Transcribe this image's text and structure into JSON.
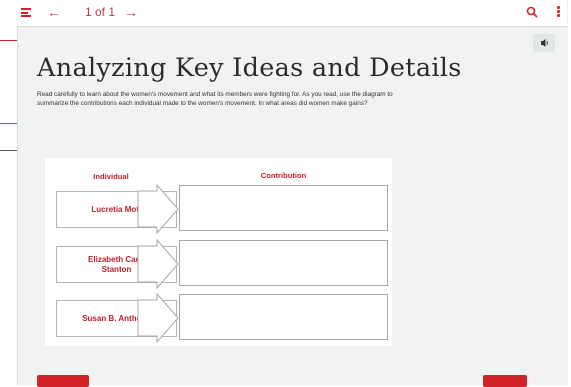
{
  "topbar": {
    "prev_arrow": "←",
    "page_indicator": "1 of 1",
    "next_arrow": "→",
    "icons": [
      "menu-icon",
      "search-icon",
      "more-vertical-icon"
    ]
  },
  "audio": {
    "icon": "speaker-icon"
  },
  "title": "Analyzing Key Ideas and Details",
  "instructions": "Read carefully to learn about the women's movement and what its members were fighting for. As you read, use the diagram to summarize the contributions each individual made to the women's movement. In what areas did women make gains?",
  "diagram": {
    "headers": {
      "individual": "Individual",
      "contribution": "Contribution"
    },
    "rows": [
      {
        "individual": "Lucretia Mott",
        "contribution": ""
      },
      {
        "individual": "Elizabeth Cady Stanton",
        "contribution": ""
      },
      {
        "individual": "Susan B. Anthony",
        "contribution": ""
      }
    ]
  },
  "colors": {
    "accent": "#d2232a",
    "label_red": "#c0202a",
    "panel_bg": "#f1f3f3"
  }
}
